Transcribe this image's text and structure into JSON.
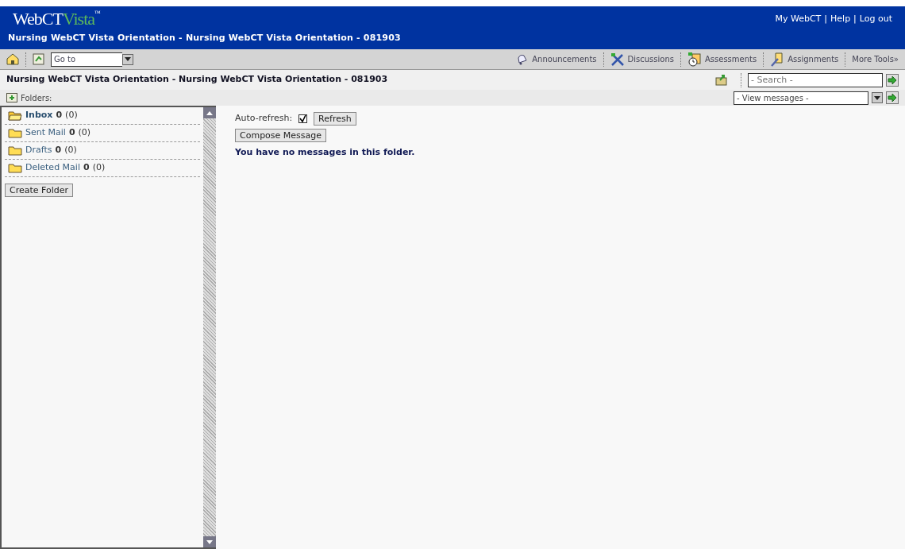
{
  "header": {
    "logo_main": "WebCT",
    "logo_accent": "Vista",
    "logo_mark": "™",
    "links": [
      "My WebCT",
      "Help",
      "Log out"
    ],
    "link_separator": "|",
    "course_title": "Nursing WebCT Vista Orientation - Nursing WebCT Vista Orientation - 081903"
  },
  "toolbar": {
    "goto": "Go to",
    "tools": [
      {
        "label": "Announcements",
        "kind": "bell"
      },
      {
        "label": "Discussions",
        "kind": "pen"
      },
      {
        "label": "Assessments",
        "kind": "clock"
      },
      {
        "label": "Assignments",
        "kind": "doc"
      }
    ],
    "more": "More Tools»"
  },
  "page_title": "Nursing WebCT Vista Orientation - Nursing WebCT Vista Orientation - 081903",
  "search": {
    "placeholder": "- Search -"
  },
  "folders_label": "Folders:",
  "view_select": "- View messages -",
  "folders": [
    {
      "name": "Inbox",
      "unread": "0",
      "total": "(0)",
      "selected": true
    },
    {
      "name": "Sent Mail",
      "unread": "0",
      "total": "(0)",
      "selected": false
    },
    {
      "name": "Drafts",
      "unread": "0",
      "total": "(0)",
      "selected": false
    },
    {
      "name": "Deleted Mail",
      "unread": "0",
      "total": "(0)",
      "selected": false
    }
  ],
  "create_folder": "Create Folder",
  "auto_refresh": {
    "label": "Auto-refresh:",
    "checked": true
  },
  "refresh": "Refresh",
  "compose": "Compose Message",
  "empty_message": "You have no messages in this folder."
}
